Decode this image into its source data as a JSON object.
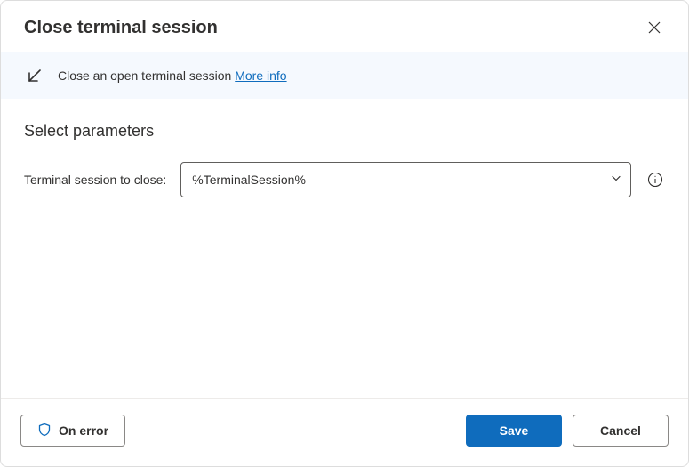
{
  "header": {
    "title": "Close terminal session"
  },
  "banner": {
    "text": "Close an open terminal session",
    "link_label": "More info"
  },
  "section": {
    "title": "Select parameters"
  },
  "params": {
    "terminal_label": "Terminal session to close:",
    "terminal_value": "%TerminalSession%"
  },
  "footer": {
    "on_error": "On error",
    "save": "Save",
    "cancel": "Cancel"
  }
}
